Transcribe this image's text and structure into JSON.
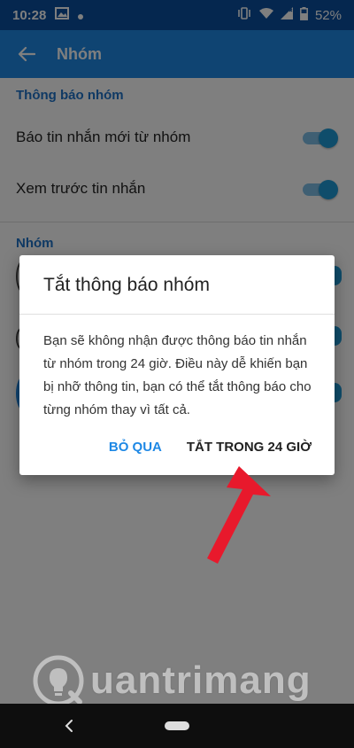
{
  "status_bar": {
    "time": "10:28",
    "battery": "52%"
  },
  "app_bar": {
    "title": "Nhóm"
  },
  "settings": {
    "section1_header": "Thông báo nhóm",
    "row1_label": "Báo tin nhắn mới từ nhóm",
    "row2_label": "Xem trước tin nhắn",
    "section2_header": "Nhóm"
  },
  "dialog": {
    "title": "Tắt thông báo nhóm",
    "body": "Bạn sẽ không nhận được thông báo tin nhắn từ nhóm trong 24 giờ. Điều này dễ khiến bạn bị nhỡ thông tin, bạn có thể tắt thông báo cho từng nhóm thay vì tất cả.",
    "skip_label": "BỎ QUA",
    "off_label": "TẮT TRONG 24 GIỜ"
  },
  "watermark": {
    "text": "uantrimang"
  },
  "colors": {
    "accent": "#1e88e5",
    "arrow": "#e8192c"
  }
}
